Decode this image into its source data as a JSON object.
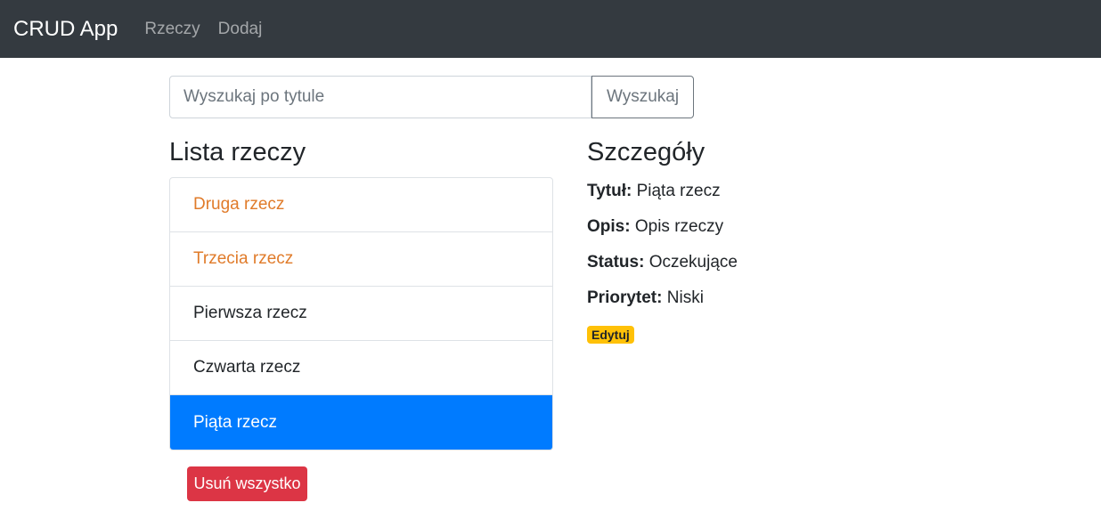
{
  "nav": {
    "brand": "CRUD App",
    "links": [
      "Rzeczy",
      "Dodaj"
    ]
  },
  "search": {
    "placeholder": "Wyszukaj po tytule",
    "button": "Wyszukaj"
  },
  "list": {
    "title": "Lista rzeczy",
    "items": [
      "Druga rzecz",
      "Trzecia rzecz",
      "Pierwsza rzecz",
      "Czwarta rzecz",
      "Piąta rzecz"
    ],
    "delete_all": "Usuń wszystko"
  },
  "details": {
    "title": "Szczegóły",
    "fields": [
      {
        "label": "Tytuł:",
        "value": "Piąta rzecz"
      },
      {
        "label": "Opis:",
        "value": "Opis rzeczy"
      },
      {
        "label": "Status:",
        "value": "Oczekujące"
      },
      {
        "label": "Priorytet:",
        "value": "Niski"
      }
    ],
    "edit": "Edytuj"
  }
}
